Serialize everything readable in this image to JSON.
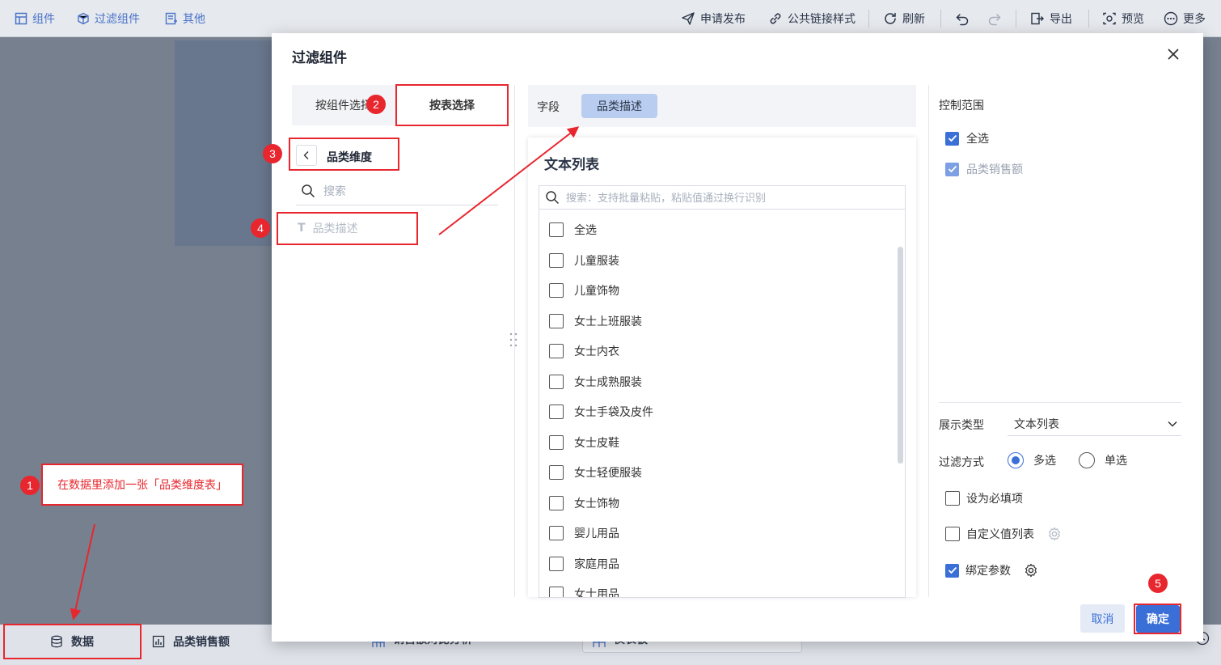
{
  "toolbar": {
    "left": [
      {
        "label": "组件",
        "icon": "component-icon"
      },
      {
        "label": "过滤组件",
        "icon": "filter-component-icon"
      },
      {
        "label": "其他",
        "icon": "other-icon"
      }
    ],
    "publish_label": "申请发布",
    "public_link_label": "公共链接样式",
    "refresh_label": "刷新",
    "export_label": "导出",
    "preview_label": "预览",
    "more_label": "更多"
  },
  "bottom": {
    "data_tab_label": "数据",
    "sales_tab_label": "品类销售额",
    "tab3_label": "销售额对比分析",
    "tab4_label": "仪表板"
  },
  "annotations": {
    "b1": "1",
    "b2": "2",
    "b3": "3",
    "b4": "4",
    "b5": "5",
    "note": "在数据里添加一张「品类维度表」"
  },
  "dialog": {
    "title": "过滤组件",
    "left_panel": {
      "tab_by_component": "按组件选择",
      "tab_by_table": "按表选择",
      "table_name": "品类维度",
      "search_placeholder": "搜索",
      "field_item": "品类描述"
    },
    "middle": {
      "field_label": "字段",
      "field_chip": "品类描述",
      "preview_title": "文本列表",
      "search_placeholder": "搜索：支持批量粘贴，粘贴值通过换行识别",
      "items": [
        "全选",
        "儿童服装",
        "儿童饰物",
        "女士上班服装",
        "女士内衣",
        "女士成熟服装",
        "女士手袋及皮件",
        "女士皮鞋",
        "女士轻便服装",
        "女士饰物",
        "婴儿用品",
        "家庭用品",
        "女士用品"
      ]
    },
    "right": {
      "scope_label": "控制范围",
      "scope_items": [
        "全选",
        "品类销售额"
      ],
      "display_type_label": "展示类型",
      "display_type_value": "文本列表",
      "filter_mode_label": "过滤方式",
      "multi_label": "多选",
      "single_label": "单选",
      "required_label": "设为必填项",
      "custom_list_label": "自定义值列表",
      "bind_param_label": "绑定参数"
    },
    "cancel_label": "取消",
    "ok_label": "确定"
  },
  "colors": {
    "accent": "#3b6fd8",
    "annotation": "#e8262e"
  }
}
